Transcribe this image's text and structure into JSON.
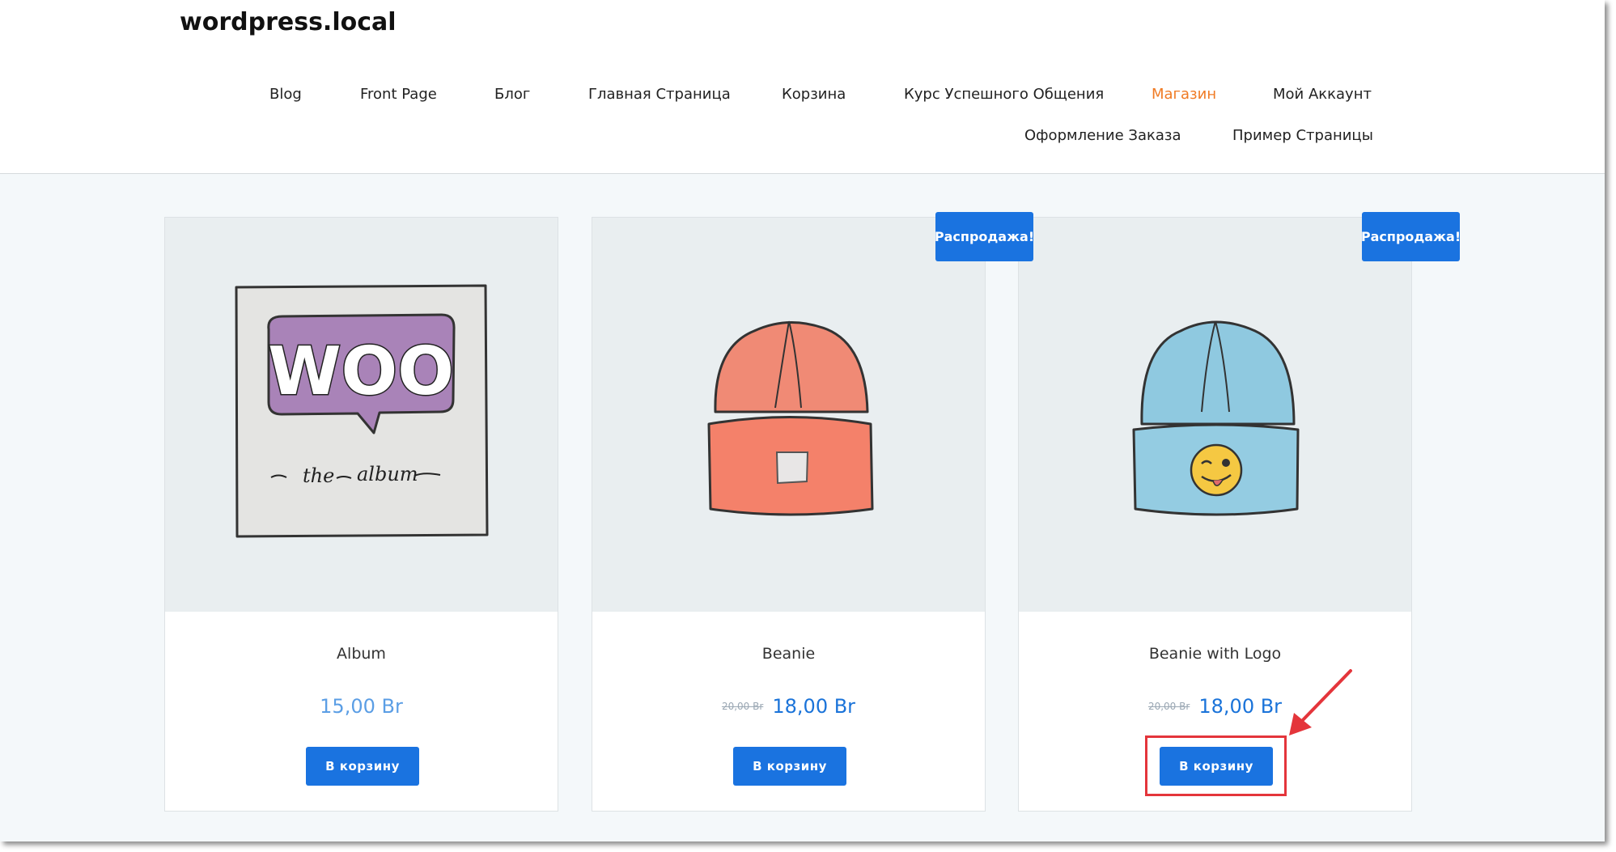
{
  "site": {
    "title": "wordpress.local"
  },
  "nav": {
    "items": [
      {
        "label": "Blog"
      },
      {
        "label": "Front Page"
      },
      {
        "label": "Блог"
      },
      {
        "label": "Главная Страница"
      },
      {
        "label": "Корзина"
      },
      {
        "label": "Курс Успешного Общения"
      },
      {
        "label": "Магазин",
        "active": true
      },
      {
        "label": "Мой Аккаунт"
      },
      {
        "label": "Оформление Заказа"
      },
      {
        "label": "Пример Страницы"
      }
    ]
  },
  "products": [
    {
      "name": "Album",
      "price": "15,00 Br",
      "old_price": "",
      "button": "В корзину",
      "sale": "",
      "image": "woo-album-icon"
    },
    {
      "name": "Beanie",
      "price": "18,00 Br",
      "old_price": "20,00 Br",
      "button": "В корзину",
      "sale": "Распродажа!",
      "image": "orange-beanie-icon"
    },
    {
      "name": "Beanie with Logo",
      "price": "18,00 Br",
      "old_price": "20,00 Br",
      "button": "В корзину",
      "sale": "Распродажа!",
      "image": "blue-beanie-logo-icon"
    }
  ],
  "album_art": {
    "logo_text": "WOO",
    "caption_1": "the",
    "caption_2": "album"
  },
  "colors": {
    "accent": "#1a73e0",
    "active_nav": "#f07b24",
    "highlight": "#e4353b"
  }
}
